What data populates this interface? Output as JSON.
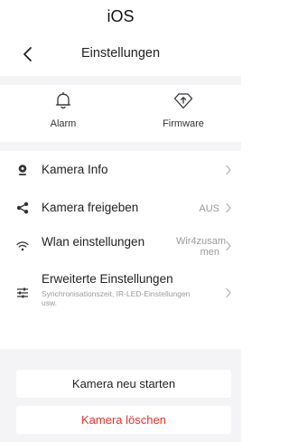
{
  "os_label": "iOS",
  "header": {
    "title": "Einstellungen"
  },
  "quick_actions": [
    {
      "label": "Alarm",
      "icon": "bell-icon"
    },
    {
      "label": "Firmware",
      "icon": "firmware-update-icon"
    }
  ],
  "settings": [
    {
      "label": "Kamera Info",
      "icon": "camera-icon",
      "value": ""
    },
    {
      "label": "Kamera freigeben",
      "icon": "share-icon",
      "value": "AUS"
    },
    {
      "label": "Wlan einstellungen",
      "icon": "wifi-icon",
      "value": "Wir4zusam men"
    },
    {
      "label": "Erweiterte Einstellungen",
      "icon": "sliders-icon",
      "subtitle": "Synchronisationszeit, IR-LED-Einstellungen usw."
    }
  ],
  "buttons": {
    "restart": "Kamera neu starten",
    "delete": "Kamera löschen"
  },
  "colors": {
    "danger": "#e8322b",
    "background_gray": "#f4f4f6"
  }
}
